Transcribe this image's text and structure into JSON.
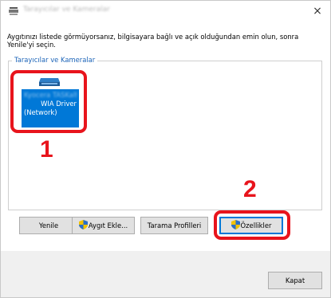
{
  "window": {
    "title": "Tarayıcılar ve Kameralar",
    "close_glyph": "×"
  },
  "instruction": "Aygıtınızı listede görmüyorsanız, bilgisayara bağlı ve açık olduğundan emin olun, sonra Yenile'yi seçin.",
  "group": {
    "legend": "Tarayıcılar ve Kameralar"
  },
  "device": {
    "name_line1": "Kyocera TASKalfa",
    "name_line2": "WIA Driver",
    "name_line3": "(Network)",
    "icon": "scanner-icon"
  },
  "callouts": {
    "one": "1",
    "two": "2"
  },
  "buttons": {
    "refresh": "Yenile",
    "add_device": "Aygıt Ekle...",
    "scan_profiles": "Tarama Profilleri",
    "properties": "Özellikler",
    "close": "Kapat"
  },
  "colors": {
    "accent": "#0078d7",
    "callout": "#e8141c",
    "legend": "#1c64b8"
  }
}
